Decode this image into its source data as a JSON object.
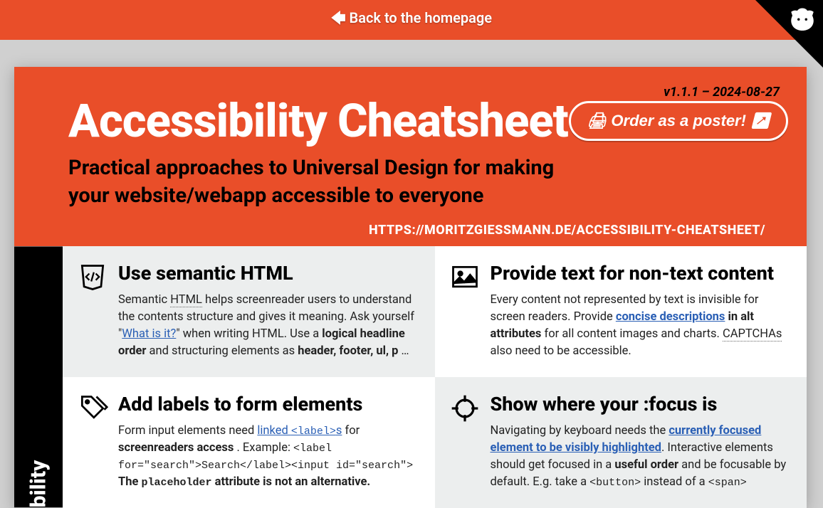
{
  "topbar": {
    "back": "🡄 Back to the homepage"
  },
  "corner": {
    "alt": "GitHub cat"
  },
  "hero": {
    "version": "v1.1.1 – 2024-08-27",
    "title": "Accessibility Cheatsheet",
    "subtitle": "Practical approaches to Universal Design for making your website/webapp accessible to everyone",
    "poster": "🖨 Order as a poster! ↗",
    "url": "HTTPS://MORITZGIESSMANN.DE/ACCESSIBILITY-CHEATSHEET/"
  },
  "sidebar": {
    "label": "bility"
  },
  "cards": [
    {
      "title": "Use semantic HTML",
      "body": "Semantic <abbr>HTML</abbr> helps screenreader users to understand the contents structure and gives it meaning. Ask yourself \"<a href='#'>What is it?</a>\" when writing HTML. Use a <b>logical headline order</b> and structuring elements as <b>header, footer, ul, p</b> …"
    },
    {
      "title": "Provide text for non-text content",
      "body": "Every content not represented by text is invisible for screen readers. Provide <a href='#'><b>concise descriptions</b></a> <b>in alt attributes</b> for all content images and charts. <abbr>CAPTCHAs</abbr> also need to be accessible."
    },
    {
      "title": "Add labels to form elements",
      "body": "Form input elements need <a href='#'>linked <span class='code'>&lt;label&gt;</span>s</a> for <b>screenreaders access</b> . Example: <span class='code'>&lt;label for=\"search\"&gt;Search&lt;/label&gt;&lt;input id=\"search\"&gt;</span><br><b>The <span class='code'>placeholder</span> attribute is not an alternative.</b>"
    },
    {
      "title": "Show where your :focus is",
      "body": "Navigating by keyboard needs the <a href='#'><b>currently focused element to be visibly highlighted</b></a>. Interactive elements should get focused in a <b>useful order</b> and be focusable by default. E.g. take a <span class='code'>&lt;button&gt;</span> instead of a <span class='code'>&lt;span&gt;</span>"
    }
  ]
}
